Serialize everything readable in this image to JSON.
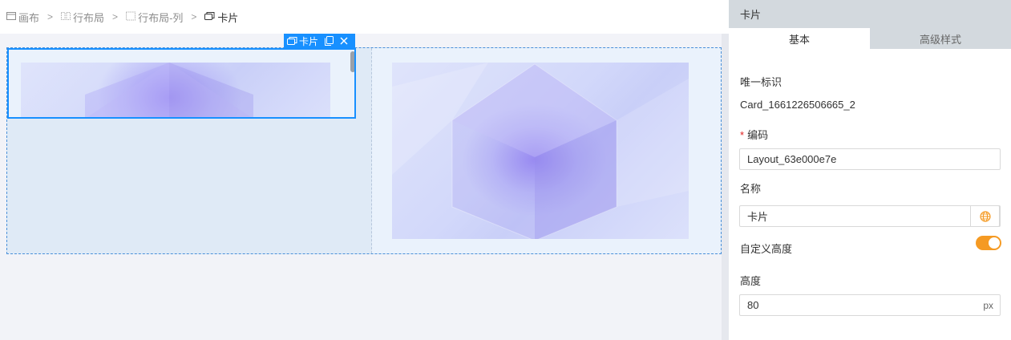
{
  "breadcrumb": {
    "items": [
      {
        "label": "画布",
        "icon": "canvas-icon"
      },
      {
        "label": "行布局",
        "icon": "row-layout-icon"
      },
      {
        "label": "行布局-列",
        "icon": "column-icon"
      },
      {
        "label": "卡片",
        "icon": "card-icon"
      }
    ],
    "separator": ">"
  },
  "canvas": {
    "selected_tag_label": "卡片",
    "selected_tag_icons": [
      "card-icon",
      "copy-icon",
      "close-icon"
    ]
  },
  "panel": {
    "title": "卡片",
    "tabs": [
      {
        "label": "基本",
        "active": true
      },
      {
        "label": "高级样式",
        "active": false
      }
    ],
    "unique_id_label": "唯一标识",
    "unique_id_value": "Card_1661226506665_2",
    "code_required_mark": "*",
    "code_label": "编码",
    "code_value": "Layout_63e000e7e",
    "name_label": "名称",
    "name_value": "卡片",
    "name_suffix_icon": "globe-icon",
    "custom_height_label": "自定义高度",
    "custom_height_enabled": true,
    "height_label": "高度",
    "height_value": "80",
    "height_unit": "px"
  },
  "colors": {
    "accent": "#1890ff",
    "toggle_on": "#f59a23",
    "panel_header": "#d3d9de"
  }
}
